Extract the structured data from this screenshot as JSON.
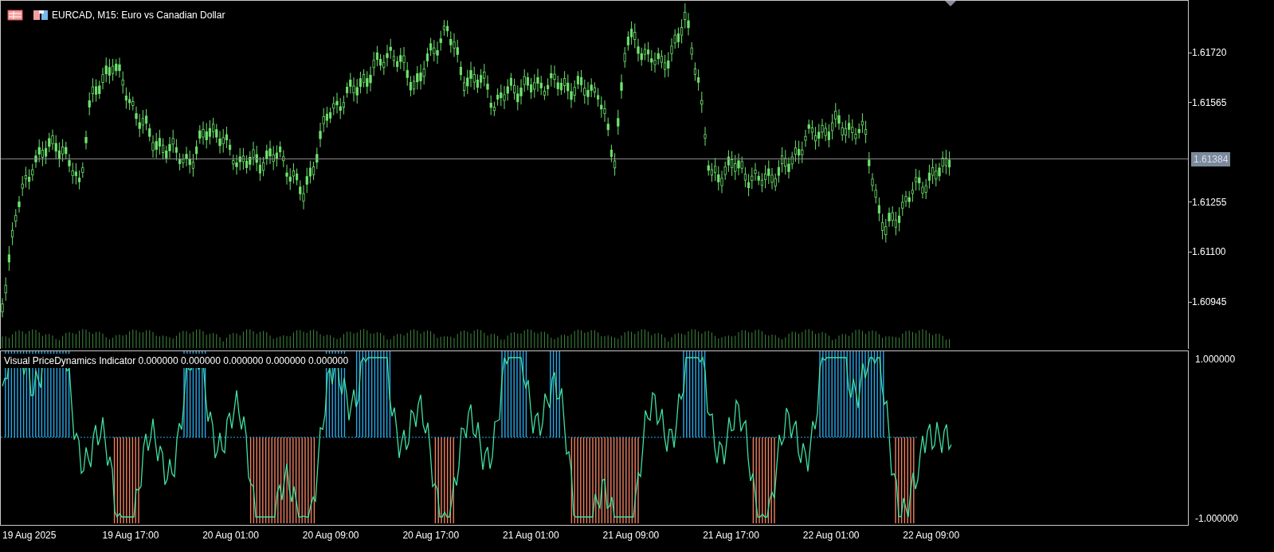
{
  "chart": {
    "title": "EURCAD, M15:  Euro vs Canadian Dollar",
    "current_price": "1.61384"
  },
  "price_axis": [
    "1.61720",
    "1.61565",
    "1.61255",
    "1.61100",
    "1.60945"
  ],
  "indicator": {
    "label": "Visual PriceDynamics Indicator 0.000000 0.000000 0.000000 0.000000 0.000000",
    "axis": [
      "1.000000",
      "-1.000000"
    ]
  },
  "time_axis": [
    "19 Aug 2025",
    "19 Aug 17:00",
    "20 Aug 01:00",
    "20 Aug 09:00",
    "20 Aug 17:00",
    "21 Aug 01:00",
    "21 Aug 09:00",
    "21 Aug 17:00",
    "22 Aug 01:00",
    "22 Aug 09:00"
  ]
}
